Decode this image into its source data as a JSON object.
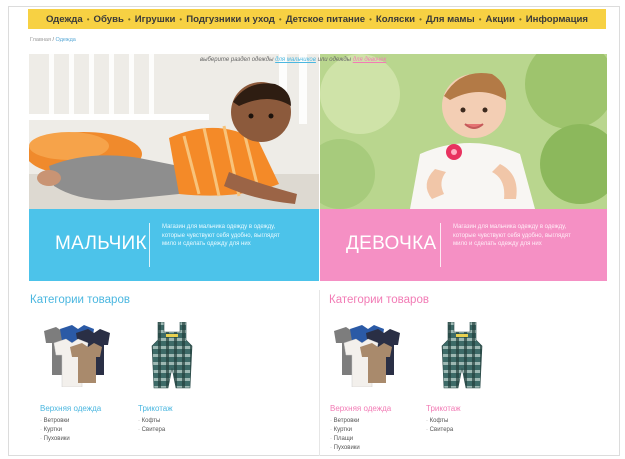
{
  "nav": {
    "items": [
      "Одежда",
      "Обувь",
      "Игрушки",
      "Подгузники и уход",
      "Детское питание",
      "Коляски",
      "Для мамы",
      "Акции",
      "Информация"
    ],
    "separator": "•",
    "background": "#f7d143"
  },
  "breadcrumb": {
    "home": "Главная",
    "separator": " / ",
    "current": "Одежда"
  },
  "chooser": {
    "prefix": "выберите раздел одежды",
    "boy_link": "для мальчиков",
    "middle": "или одежды",
    "girl_link": "для девочек"
  },
  "boy": {
    "banner_title": "МАЛЬЧИК",
    "banner_text": "Магазин для мальчика одежду в одежду, которые чувствуют себя удобно, выглядят мило и сделать одежду для них",
    "color": "#4cc3ea",
    "categories_title": "Категории товаров",
    "groups": [
      {
        "title": "Верхняя одежда",
        "items": [
          "Ветровки",
          "Куртки",
          "Пуховики"
        ]
      },
      {
        "title": "Трикотаж",
        "items": [
          "Кофты",
          "Свитера"
        ]
      }
    ]
  },
  "girl": {
    "banner_title": "ДЕВОЧКА",
    "banner_text": "Магазин для мальчика одежду в одежду, которые чувствуют себя удобно, выглядят мило и сделать одежду для них",
    "color": "#f590c4",
    "categories_title": "Категории товаров",
    "groups": [
      {
        "title": "Верхняя одежда",
        "items": [
          "Ветровки",
          "Куртки",
          "Плащи",
          "Пуховики"
        ]
      },
      {
        "title": "Трикотаж",
        "items": [
          "Кофты",
          "Свитера"
        ]
      }
    ]
  }
}
